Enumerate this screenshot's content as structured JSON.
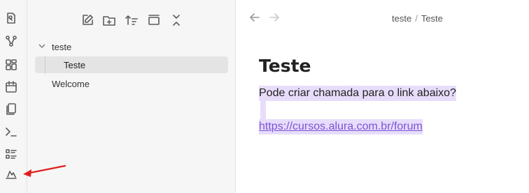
{
  "ribbon": {
    "icons": [
      "open-quick-switcher-icon",
      "graph-view-icon",
      "canvas-icon",
      "daily-note-icon",
      "templates-icon",
      "command-palette-icon",
      "slides-icon",
      "publish-icon"
    ]
  },
  "sidebar": {
    "toolbar": [
      "new-note-icon",
      "new-folder-icon",
      "sort-icon",
      "collapse-icon",
      "collapse-all-icon"
    ],
    "tree": {
      "folder": "teste",
      "active_file": "Teste",
      "other_file": "Welcome"
    }
  },
  "main": {
    "breadcrumb": {
      "folder": "teste",
      "separator": "/",
      "file": "Teste"
    },
    "title": "Teste",
    "paragraph": "Pode criar chamada para o link abaixo?",
    "link": "https://cursos.alura.com.br/forum"
  },
  "colors": {
    "highlight": "#e7ddfb",
    "link": "#7b53d6",
    "annotation_arrow": "#e02020"
  }
}
